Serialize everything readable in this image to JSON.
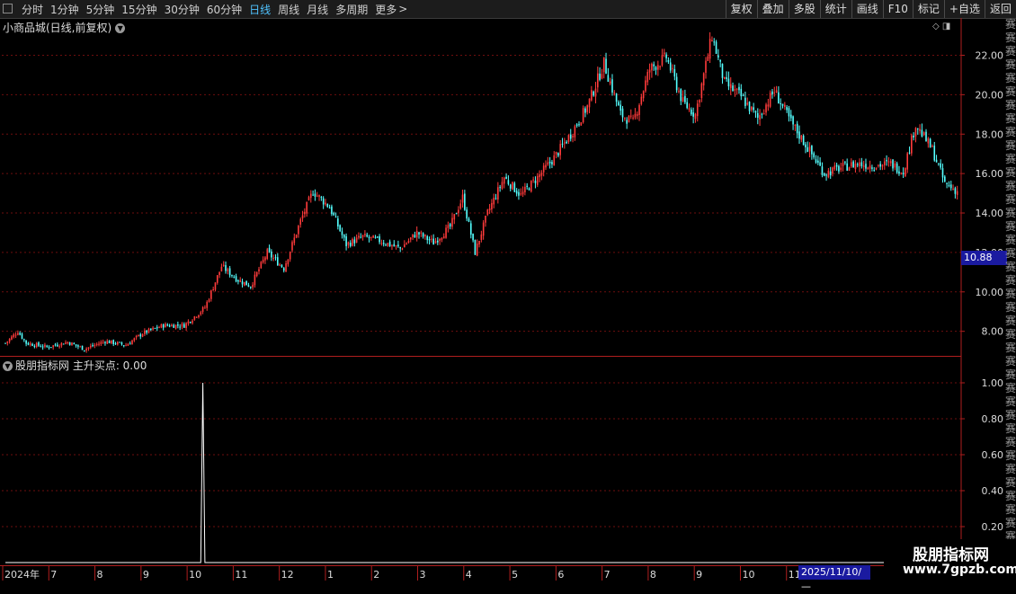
{
  "toolbar": {
    "periods": [
      "分时",
      "1分钟",
      "5分钟",
      "15分钟",
      "30分钟",
      "60分钟",
      "日线",
      "周线",
      "月线",
      "多周期",
      "更多"
    ],
    "active_period": "日线",
    "more_suffix": ">",
    "right_buttons": [
      "复权",
      "叠加",
      "多股",
      "统计",
      "画线",
      "F10",
      "标记",
      "+自选",
      "返回"
    ]
  },
  "main_title": "小商品城(日线,前复权)",
  "indicator_title": "股朋指标网 主升买点: 0.00",
  "current_price": "10.88",
  "crosshair_date": "2025/11/10/—",
  "watermark": {
    "line1": "股朋指标网",
    "line2": "www.7gpzb.com"
  },
  "right_strip_text": "赛赛赛赛赛赛赛赛赛赛赛赛赛赛赛赛赛赛赛赛赛赛赛赛赛赛赛赛赛赛赛赛赛赛赛赛赛赛赛赛",
  "colors": {
    "up": "#ff3b3b",
    "down": "#54ffff",
    "grid": "#6e0e0e",
    "axis": "#b01e1e",
    "accent": "#1a1aa0"
  },
  "chart_data": [
    {
      "type": "candlestick",
      "title": "小商品城(日线,前复权)",
      "ylim": [
        6.8,
        23.8
      ],
      "yticks": [
        8,
        10,
        12,
        14,
        16,
        18,
        20,
        22
      ],
      "ytick_labels": [
        "8.00",
        "10.00",
        "12.00",
        "14.00",
        "16.00",
        "18.00",
        "20.00",
        "22.00"
      ],
      "grid": true,
      "x_labels": [
        "2024年",
        "7",
        "8",
        "9",
        "10",
        "11",
        "12",
        "1",
        "2",
        "3",
        "4",
        "5",
        "6",
        "7",
        "8",
        "9",
        "10",
        "11"
      ],
      "close_path": [
        {
          "i": 0,
          "v": 7.4
        },
        {
          "i": 6,
          "v": 8.0
        },
        {
          "i": 10,
          "v": 7.4
        },
        {
          "i": 20,
          "v": 7.2
        },
        {
          "i": 30,
          "v": 7.45
        },
        {
          "i": 38,
          "v": 7.1
        },
        {
          "i": 48,
          "v": 7.5
        },
        {
          "i": 58,
          "v": 7.3
        },
        {
          "i": 66,
          "v": 7.9
        },
        {
          "i": 76,
          "v": 8.3
        },
        {
          "i": 86,
          "v": 8.3
        },
        {
          "i": 96,
          "v": 9.2
        },
        {
          "i": 104,
          "v": 11.3
        },
        {
          "i": 112,
          "v": 10.6
        },
        {
          "i": 118,
          "v": 10.3
        },
        {
          "i": 126,
          "v": 12.0
        },
        {
          "i": 134,
          "v": 11.2
        },
        {
          "i": 142,
          "v": 13.6
        },
        {
          "i": 148,
          "v": 15.1
        },
        {
          "i": 156,
          "v": 14.3
        },
        {
          "i": 164,
          "v": 12.4
        },
        {
          "i": 172,
          "v": 12.8
        },
        {
          "i": 180,
          "v": 12.6
        },
        {
          "i": 190,
          "v": 12.2
        },
        {
          "i": 198,
          "v": 13.0
        },
        {
          "i": 206,
          "v": 12.5
        },
        {
          "i": 214,
          "v": 13.3
        },
        {
          "i": 220,
          "v": 14.8
        },
        {
          "i": 226,
          "v": 12.0
        },
        {
          "i": 232,
          "v": 14.0
        },
        {
          "i": 240,
          "v": 15.8
        },
        {
          "i": 248,
          "v": 14.9
        },
        {
          "i": 256,
          "v": 15.8
        },
        {
          "i": 264,
          "v": 16.8
        },
        {
          "i": 272,
          "v": 18.0
        },
        {
          "i": 280,
          "v": 19.4
        },
        {
          "i": 288,
          "v": 21.6
        },
        {
          "i": 296,
          "v": 19.0
        },
        {
          "i": 302,
          "v": 18.6
        },
        {
          "i": 310,
          "v": 21.3
        },
        {
          "i": 318,
          "v": 21.9
        },
        {
          "i": 326,
          "v": 19.6
        },
        {
          "i": 332,
          "v": 19.0
        },
        {
          "i": 340,
          "v": 23.0
        },
        {
          "i": 346,
          "v": 20.6
        },
        {
          "i": 354,
          "v": 19.9
        },
        {
          "i": 362,
          "v": 18.8
        },
        {
          "i": 370,
          "v": 20.2
        },
        {
          "i": 378,
          "v": 18.6
        },
        {
          "i": 386,
          "v": 17.3
        },
        {
          "i": 394,
          "v": 16.0
        },
        {
          "i": 402,
          "v": 16.3
        },
        {
          "i": 410,
          "v": 16.5
        },
        {
          "i": 418,
          "v": 16.4
        },
        {
          "i": 426,
          "v": 16.5
        },
        {
          "i": 432,
          "v": 16.1
        },
        {
          "i": 438,
          "v": 18.5
        },
        {
          "i": 446,
          "v": 17.2
        },
        {
          "i": 452,
          "v": 15.5
        },
        {
          "i": 458,
          "v": 15.1
        }
      ]
    },
    {
      "type": "line",
      "title": "主升买点",
      "ylim": [
        0,
        1.1
      ],
      "yticks": [
        0.2,
        0.4,
        0.6,
        0.8,
        1.0
      ],
      "ytick_labels": [
        "0.20",
        "0.40",
        "0.60",
        "0.80",
        "1.00"
      ],
      "series": [
        {
          "name": "主升买点",
          "points": [
            {
              "i": 0,
              "v": 0
            },
            {
              "i": 94,
              "v": 0
            },
            {
              "i": 95,
              "v": 1.0
            },
            {
              "i": 96,
              "v": 0
            },
            {
              "i": 458,
              "v": 0
            }
          ]
        }
      ]
    }
  ]
}
